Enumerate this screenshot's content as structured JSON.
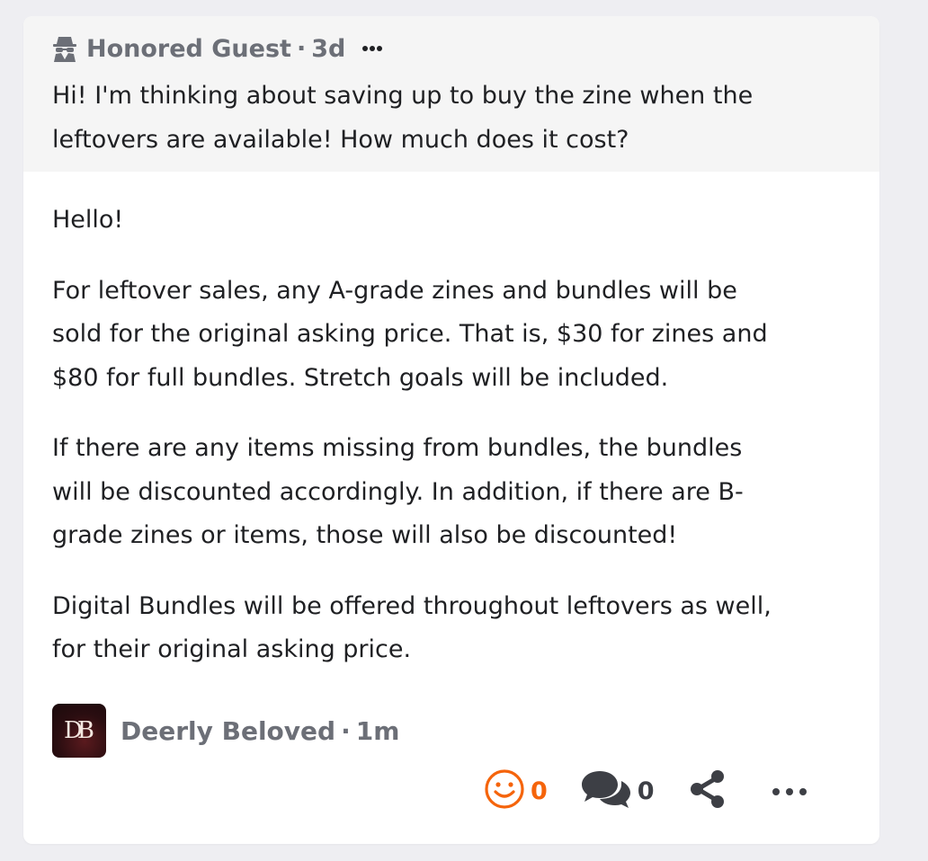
{
  "question": {
    "author": "Honored Guest",
    "separator": "·",
    "time": "3d",
    "author_icon": "spy-icon",
    "text": "Hi! I'm thinking about saving up to buy the zine when the leftovers are available! How much does it cost?"
  },
  "answer": {
    "paragraphs": [
      [
        "Hello!"
      ],
      [
        "For leftover sales, any A-grade zines and bundles will be",
        "sold for the original asking price. That is, $30 for zines and",
        "$80 for full bundles. Stretch goals will be included."
      ],
      [
        "If there are any items missing from bundles, the bundles",
        "will be discounted accordingly. In addition, if there are B-",
        "grade zines or items, those will also be discounted!"
      ],
      [
        "Digital Bundles will be offered throughout leftovers as well,",
        "for their original asking price."
      ]
    ],
    "author": "Deerly Beloved",
    "separator": "·",
    "time": "1m",
    "avatar_text": "DB"
  },
  "actions": {
    "react_icon": "smiley-icon",
    "react_count": "0",
    "comment_icon": "comments-icon",
    "comment_count": "0",
    "share_icon": "share-icon",
    "more_icon": "more-icon"
  },
  "colors": {
    "accent": "#f5640b",
    "muted": "#6c6f77",
    "text": "#1f2023",
    "background": "#eeeef2"
  }
}
